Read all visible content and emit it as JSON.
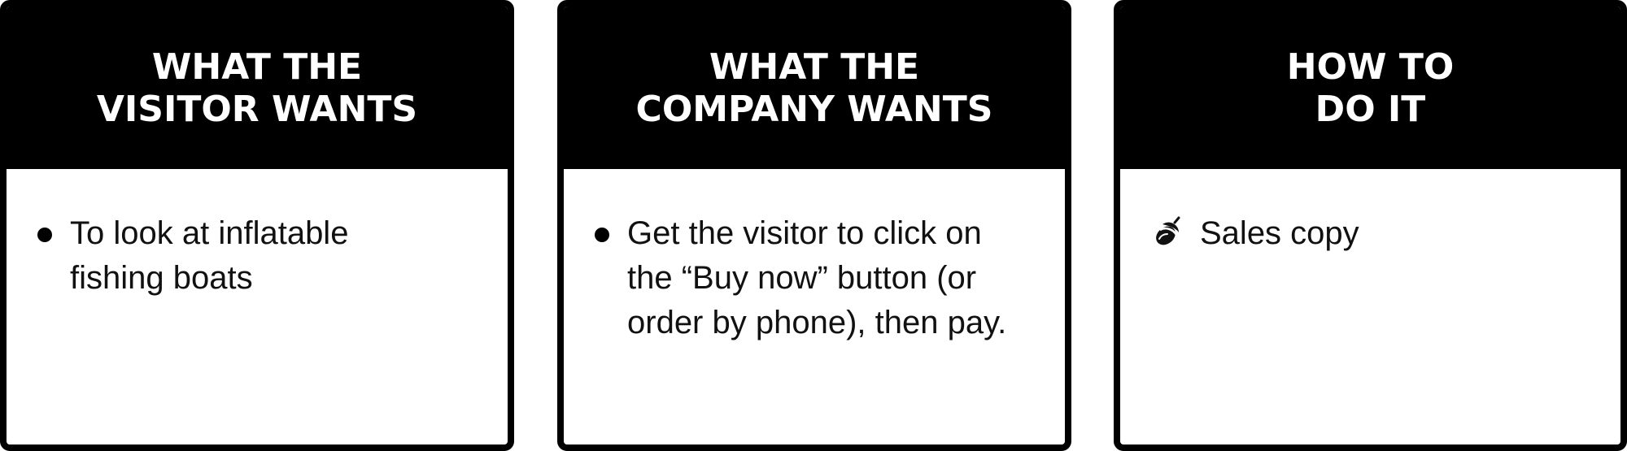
{
  "cards": [
    {
      "title_lines": [
        "WHAT THE",
        "VISITOR WANTS"
      ],
      "item": "To look at inflatable fishing boats",
      "marker": "bullet"
    },
    {
      "title_lines": [
        "WHAT THE",
        "COMPANY WANTS"
      ],
      "item": "Get the visitor to click on the “Buy now” button (or order by phone), then pay.",
      "marker": "bullet"
    },
    {
      "title_lines": [
        "HOW TO",
        "DO IT"
      ],
      "item": "Sales copy",
      "marker": "acorn-icon"
    }
  ]
}
